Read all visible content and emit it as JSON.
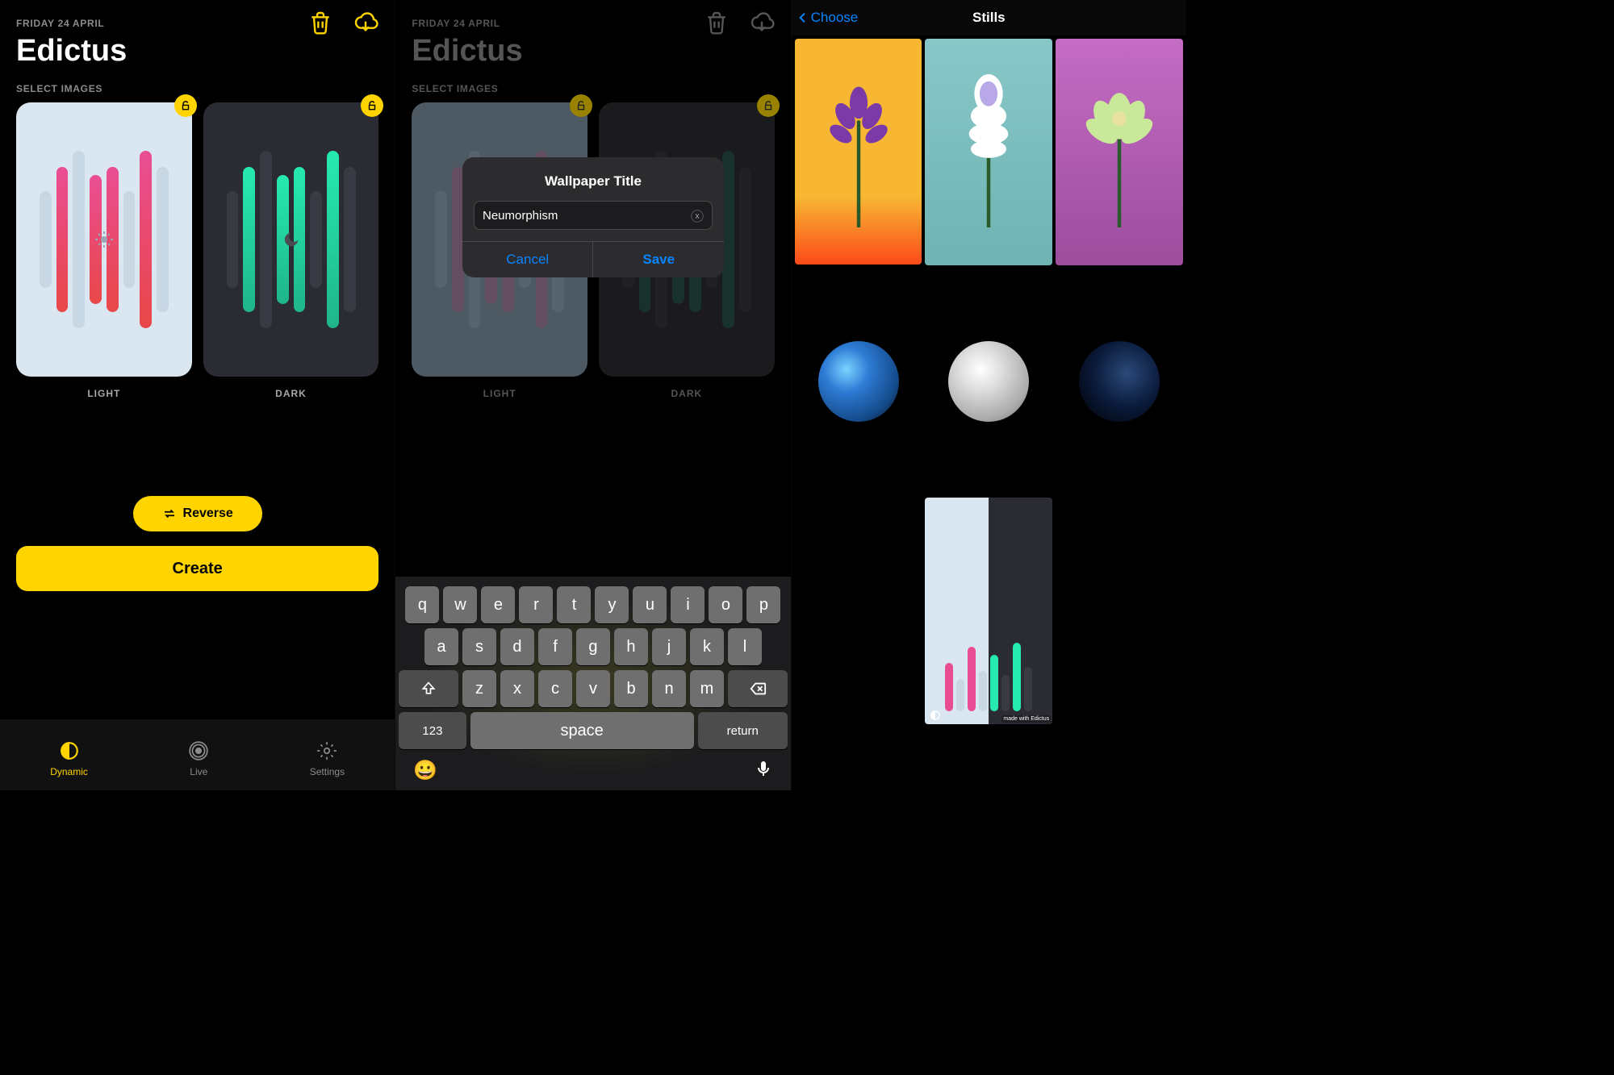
{
  "pane1": {
    "date": "FRIDAY 24 APRIL",
    "title": "Edictus",
    "section": "SELECT IMAGES",
    "cards": {
      "light": "LIGHT",
      "dark": "DARK"
    },
    "reverse": "Reverse",
    "create": "Create",
    "tabs": {
      "dynamic": "Dynamic",
      "live": "Live",
      "settings": "Settings"
    },
    "topicons": {
      "trash": "trash",
      "download": "download"
    }
  },
  "pane2": {
    "date": "FRIDAY 24 APRIL",
    "title": "Edictus",
    "section": "SELECT IMAGES",
    "cards": {
      "light": "LIGHT",
      "dark": "DARK"
    },
    "alert": {
      "title": "Wallpaper Title",
      "value": "Neumorphism",
      "cancel": "Cancel",
      "save": "Save"
    },
    "keyboard": {
      "row1": [
        "q",
        "w",
        "e",
        "r",
        "t",
        "y",
        "u",
        "i",
        "o",
        "p"
      ],
      "row2": [
        "a",
        "s",
        "d",
        "f",
        "g",
        "h",
        "j",
        "k",
        "l"
      ],
      "row3": [
        "z",
        "x",
        "c",
        "v",
        "b",
        "n",
        "m"
      ],
      "num": "123",
      "space": "space",
      "return": "return"
    }
  },
  "pane3": {
    "back": "Choose",
    "title": "Stills",
    "thumbs": [
      {
        "kind": "flower1",
        "name": "still-flower-purple-on-orange"
      },
      {
        "kind": "flower2",
        "name": "still-flower-white-on-teal"
      },
      {
        "kind": "flower3",
        "name": "still-flower-green-on-magenta"
      },
      {
        "kind": "earth",
        "name": "still-earth-day"
      },
      {
        "kind": "moon",
        "name": "still-moon"
      },
      {
        "kind": "earthn",
        "name": "still-earth-night"
      },
      {
        "kind": "black",
        "name": "still-black"
      },
      {
        "kind": "split",
        "name": "still-edictus-split"
      }
    ],
    "watermark": "made with Edictus"
  },
  "colors": {
    "accent": "#ffd400",
    "link": "#0a84ff"
  }
}
